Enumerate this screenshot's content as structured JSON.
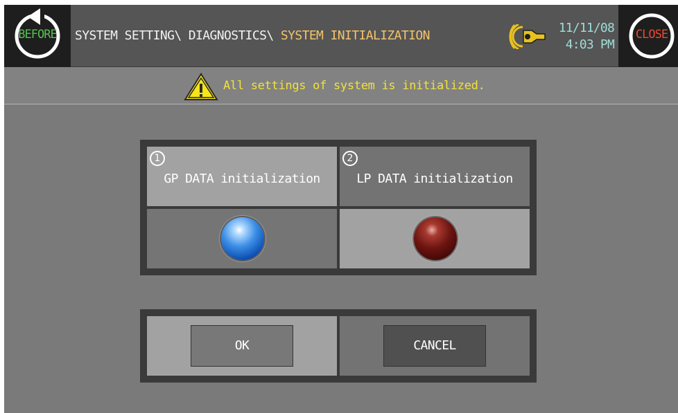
{
  "header": {
    "before_label": "BEFORE",
    "close_label": "CLOSE",
    "breadcrumb_path": "SYSTEM SETTING\\ DIAGNOSTICS\\ ",
    "breadcrumb_current": "SYSTEM INITIALIZATION",
    "date": "11/11/08",
    "time": "4:03 PM"
  },
  "message": {
    "text": "All settings of system is initialized."
  },
  "init_panel": {
    "gp": {
      "number": "1",
      "label": "GP DATA initialization",
      "lamp_state": "on",
      "lamp_color": "#2f7fd8"
    },
    "lp": {
      "number": "2",
      "label": "LP DATA initialization",
      "lamp_state": "off",
      "lamp_color": "#6b1410"
    }
  },
  "actions": {
    "ok_label": "OK",
    "cancel_label": "CANCEL"
  },
  "icons": {
    "before": "back-arrow-icon",
    "close": "close-icon",
    "alarm": "alarm-speaker-icon",
    "warning": "warning-triangle-icon"
  },
  "colors": {
    "breadcrumb_current": "#f4c46a",
    "message": "#f2e13a",
    "datetime": "#9fdcd8",
    "before": "#54c24e",
    "close": "#ea4a2e"
  }
}
